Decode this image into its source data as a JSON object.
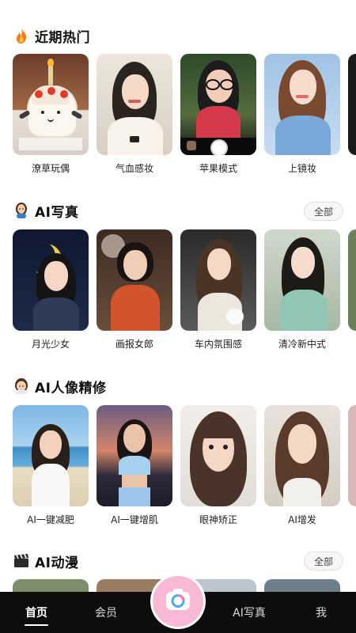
{
  "sections": [
    {
      "title": "近期热门",
      "icon": "fire-icon",
      "has_all": false,
      "items": [
        "潦草玩偶",
        "气血感妆",
        "苹果模式",
        "上镜妆"
      ]
    },
    {
      "title": "AI写真",
      "icon": "woman-artist-icon",
      "has_all": true,
      "all_label": "全部",
      "items": [
        "月光少女",
        "画报女郎",
        "车内氛围感",
        "清冷新中式"
      ]
    },
    {
      "title": "AI人像精修",
      "icon": "girl-face-icon",
      "has_all": false,
      "items": [
        "AI一键减肥",
        "AI一键增肌",
        "眼神矫正",
        "AI增发"
      ]
    },
    {
      "title": "AI动漫",
      "icon": "clapper-board-icon",
      "has_all": true,
      "all_label": "全部"
    }
  ],
  "tabbar": {
    "items": [
      "首页",
      "会员",
      "AI写真",
      "我"
    ],
    "active": "首页",
    "center_icon": "camera-icon"
  },
  "colors": {
    "tabbar_bg": "#0d0d0d",
    "camera_button": "#f7b9d6"
  }
}
